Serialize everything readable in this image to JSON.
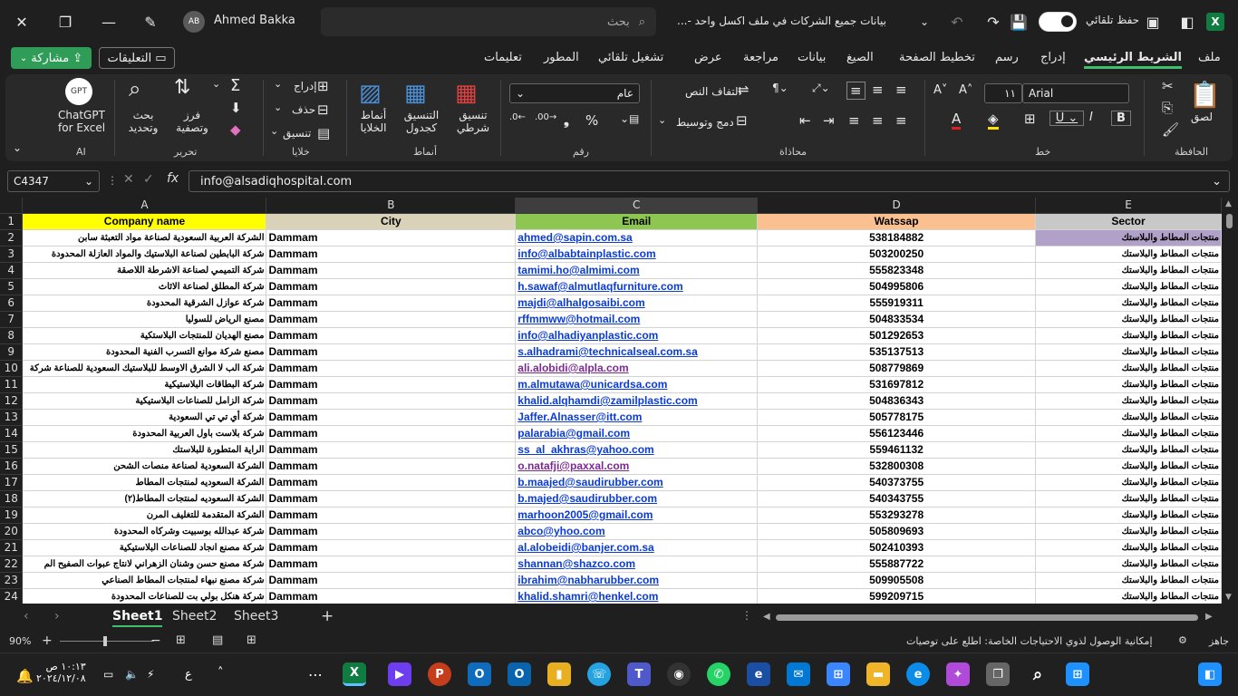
{
  "titlebar": {
    "user_name": "Ahmed Bakka",
    "user_initials": "AB",
    "search_placeholder": "بحث",
    "doc_title": "بيانات جميع الشركات في ملف اكسل واحد -...",
    "autosave_label": "حفظ تلقائي"
  },
  "tabs": [
    "ملف",
    "الشريط الرئيسي",
    "إدراج",
    "رسم",
    "تخطيط الصفحة",
    "الصيغ",
    "بيانات",
    "مراجعة",
    "عرض",
    "تشغيل تلقائي",
    "المطور",
    "تعليمات"
  ],
  "share_label": "مشاركة",
  "comments_label": "التعليقات",
  "ribbon": {
    "clipboard_label": "الحافظة",
    "paste_label": "لصق",
    "font_label": "خط",
    "font_name": "Arial",
    "font_size": "١١",
    "alignment_label": "محاذاة",
    "wrap_text": "التفاف النص",
    "merge_center": "دمج وتوسيط",
    "number_label": "رقم",
    "number_format": "عام",
    "styles_label": "أنماط",
    "cond_format": "تنسيق شرطي",
    "format_table": "التنسيق كجدول",
    "cell_styles": "أنماط الخلايا",
    "cells_label": "خلايا",
    "insert": "إدراج",
    "delete": "حذف",
    "format": "تنسيق",
    "editing_label": "تحرير",
    "sort_filter": "فرز وتصفية",
    "find_select": "بحث وتحديد",
    "ai_label": "AI",
    "chatgpt": "ChatGPT",
    "for_excel": "for Excel"
  },
  "formula_bar": {
    "name_box": "C4347",
    "formula": "info@alsadiqhospital.com"
  },
  "columns": [
    "A",
    "B",
    "C",
    "D",
    "E"
  ],
  "headers": [
    "Company name",
    "City",
    "Email",
    "Watssap",
    "Sector"
  ],
  "header_colors": [
    "#ffff00",
    "#d9d2b8",
    "#8dc650",
    "#fac090",
    "#c8c8c8"
  ],
  "rows": [
    {
      "n": "2",
      "a": "الشركة العربية السعودية لصناعة مواد التعبئة سابن",
      "b": "Dammam",
      "c": "ahmed@sapin.com.sa",
      "d": "538184882",
      "e": "منتجات المطاط والبلاستك"
    },
    {
      "n": "3",
      "a": "شركة البابطين لصناعة البلاستيك والمواد العازلة المحدودة",
      "b": "Dammam",
      "c": "info@albabtainplastic.com",
      "d": "503200250",
      "e": "منتجات المطاط والبلاستك"
    },
    {
      "n": "4",
      "a": "شركة التميمي لصناعة الاشرطة اللاصقة",
      "b": "Dammam",
      "c": "tamimi.ho@almimi.com",
      "d": "555823348",
      "e": "منتجات المطاط والبلاستك"
    },
    {
      "n": "5",
      "a": "شركة المطلق لصناعة الاثاث",
      "b": "Dammam",
      "c": "h.sawaf@almutlaqfurniture.com",
      "d": "504995806",
      "e": "منتجات المطاط والبلاستك"
    },
    {
      "n": "6",
      "a": "شركة عوازل الشرقية المحدودة",
      "b": "Dammam",
      "c": "majdi@alhalgosaibi.com",
      "d": "555919311",
      "e": "منتجات المطاط والبلاستك"
    },
    {
      "n": "7",
      "a": "مصنع الرياض للسوليا",
      "b": "Dammam",
      "c": "rffmmww@hotmail.com",
      "d": "504833534",
      "e": "منتجات المطاط والبلاستك"
    },
    {
      "n": "8",
      "a": "مصنع الهديان للمنتجات البلاستكية",
      "b": "Dammam",
      "c": "info@alhadiyanplastic.com",
      "d": "501292653",
      "e": "منتجات المطاط والبلاستك"
    },
    {
      "n": "9",
      "a": "مصنع شركة موانع التسرب الفنية المحدودة",
      "b": "Dammam",
      "c": "s.alhadrami@technicalseal.com.sa",
      "d": "535137513",
      "e": "منتجات المطاط والبلاستك"
    },
    {
      "n": "10",
      "a": "شركة الب لا الشرق الاوسط للبلاستيك السعودية للصناعة شركة",
      "b": "Dammam",
      "c": "ali.alobidi@alpla.com",
      "d": "508779869",
      "e": "منتجات المطاط والبلاستك",
      "visited": true
    },
    {
      "n": "11",
      "a": "شركة البطاقات البلاستيكية",
      "b": "Dammam",
      "c": "m.almutawa@unicardsa.com",
      "d": "531697812",
      "e": "منتجات المطاط والبلاستك"
    },
    {
      "n": "12",
      "a": "شركة الزامل للصناعات البلاستيكية",
      "b": "Dammam",
      "c": "khalid.alqhamdi@zamilplastic.com",
      "d": "504836343",
      "e": "منتجات المطاط والبلاستك"
    },
    {
      "n": "13",
      "a": "شركة أي تي تي السعودية",
      "b": "Dammam",
      "c": "Jaffer.Alnasser@itt.com",
      "d": "505778175",
      "e": "منتجات المطاط والبلاستك"
    },
    {
      "n": "14",
      "a": "شركة بلاست باول العربية المحدودة",
      "b": "Dammam",
      "c": "palarabia@gmail.com",
      "d": "556123446",
      "e": "منتجات المطاط والبلاستك"
    },
    {
      "n": "15",
      "a": "الراية المتطورة للبلاستك",
      "b": "Dammam",
      "c": "ss_al_akhras@yahoo.com",
      "d": "559461132",
      "e": "منتجات المطاط والبلاستك"
    },
    {
      "n": "16",
      "a": "الشركة السعودية لصناعة منصات الشحن",
      "b": "Dammam",
      "c": "o.natafji@paxxal.com",
      "d": "532800308",
      "e": "منتجات المطاط والبلاستك",
      "visited": true
    },
    {
      "n": "17",
      "a": "الشركة السعوديه لمنتجات المطاط",
      "b": "Dammam",
      "c": "b.maajed@saudirubber.com",
      "d": "540373755",
      "e": "منتجات المطاط والبلاستك"
    },
    {
      "n": "18",
      "a": "الشركة السعوديه لمنتجات المطاط(٢)",
      "b": "Dammam",
      "c": "b.majed@saudirubber.com",
      "d": "540343755",
      "e": "منتجات المطاط والبلاستك"
    },
    {
      "n": "19",
      "a": "الشركة المتقدمة للتغليف المرن",
      "b": "Dammam",
      "c": "marhoon2005@gmail.com",
      "d": "553293278",
      "e": "منتجات المطاط والبلاستك"
    },
    {
      "n": "20",
      "a": "شركة عبدالله بوسبيت وشركاه المحدودة",
      "b": "Dammam",
      "c": "abco@yhoo.com",
      "d": "505809693",
      "e": "منتجات المطاط والبلاستك"
    },
    {
      "n": "21",
      "a": "شركة مصنع انجاد للصناعات البلاستيكية",
      "b": "Dammam",
      "c": "al.alobeidi@banjer.com.sa",
      "d": "502410393",
      "e": "منتجات المطاط والبلاستك"
    },
    {
      "n": "22",
      "a": "شركة مصنع حسن وشنان الزهراني لانتاج عبوات الصفيح الم",
      "b": "Dammam",
      "c": "shannan@shazco.com",
      "d": "555887722",
      "e": "منتجات المطاط والبلاستك"
    },
    {
      "n": "23",
      "a": "شركة مصنع نبهاء لمنتجات المطاط الصناعي",
      "b": "Dammam",
      "c": "ibrahim@nabharubber.com",
      "d": "509905508",
      "e": "منتجات المطاط والبلاستك"
    },
    {
      "n": "24",
      "a": "شركة هنكل بولي بت للصناعات المحدودة",
      "b": "Dammam",
      "c": "khalid.shamri@henkel.com",
      "d": "599209715",
      "e": "منتجات المطاط والبلاستك"
    }
  ],
  "sheets": [
    "Sheet1",
    "Sheet2",
    "Sheet3"
  ],
  "status": {
    "zoom": "90%",
    "ready": "جاهز",
    "accessibility": "إمكانية الوصول لذوي الاحتياجات الخاصة: اطلع على توصيات"
  },
  "taskbar": {
    "time": "١٠:١٣ ص",
    "date": "٢٠٢٤/١٢/٠٨",
    "lang": "ع"
  },
  "colors": {
    "accent": "#107c41",
    "share_green": "#2f9d57",
    "link": "#0b3bd6",
    "visited_link": "#7a2b8f"
  }
}
